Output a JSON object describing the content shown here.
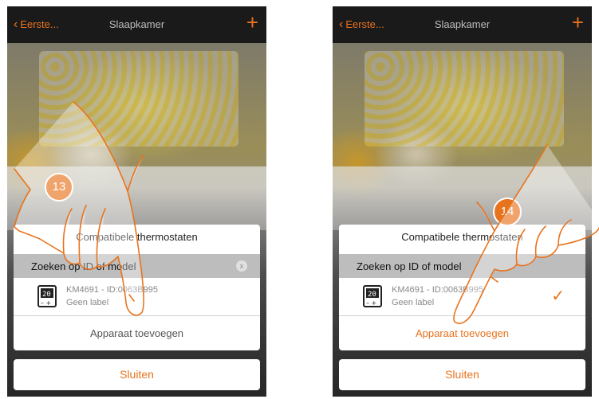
{
  "colors": {
    "accent": "#e8731e",
    "navbar": "#1a1a1a",
    "search_row": "#bdbdbd"
  },
  "screens": [
    {
      "navbar": {
        "back_label": "Eerste...",
        "title": "Slaapkamer",
        "add_label": "+"
      },
      "dialog": {
        "title": "Compatibele thermostaten",
        "search": {
          "value": "Zoeken op ID of model",
          "clear_label": "x"
        },
        "device": {
          "name": "KM4691 - ID:0063B995",
          "label": "Geen label",
          "icon": "thermostat-icon"
        },
        "add_button": "Apparaat toevoegen"
      },
      "close_button": "Sluiten",
      "step": "13"
    },
    {
      "navbar": {
        "back_label": "Eerste...",
        "title": "Slaapkamer",
        "add_label": "+"
      },
      "dialog": {
        "title": "Compatibele thermostaten",
        "search": {
          "value": "Zoeken op ID of model"
        },
        "device": {
          "name": "KM4691 - ID:0063B995",
          "label": "Geen label",
          "icon": "thermostat-icon",
          "checked": true
        },
        "add_button": "Apparaat toevoegen"
      },
      "close_button": "Sluiten",
      "step": "14"
    }
  ]
}
